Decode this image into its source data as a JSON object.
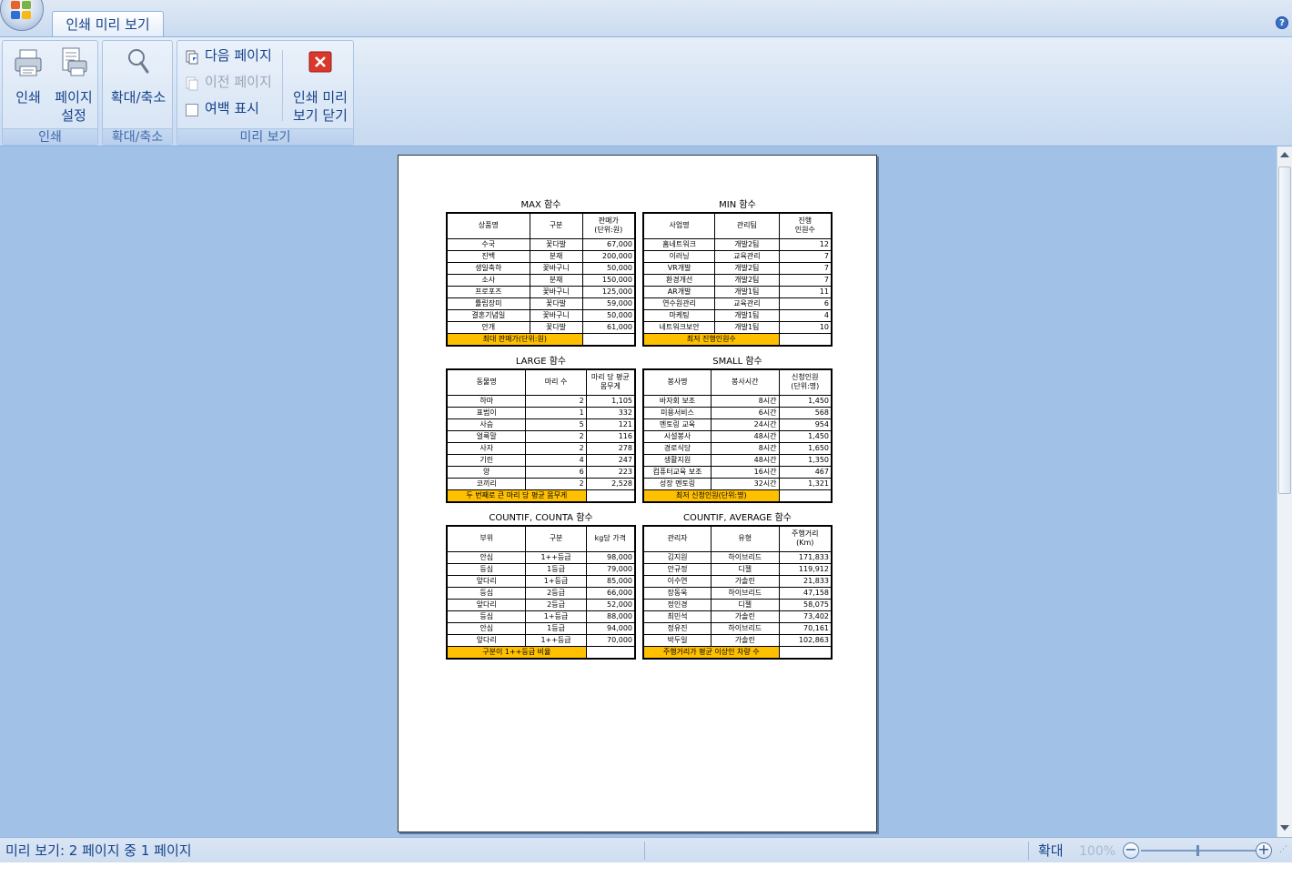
{
  "ribbon": {
    "tab": "인쇄 미리 보기",
    "groups": {
      "print": {
        "caption": "인쇄",
        "print_label": "인쇄",
        "page_setup_label_1": "페이지",
        "page_setup_label_2": "설정"
      },
      "zoom": {
        "caption": "확대/축소",
        "zoom_label": "확대/축소"
      },
      "preview": {
        "caption": "미리 보기",
        "next_page": "다음 페이지",
        "prev_page": "이전 페이지",
        "show_margins": "여백 표시",
        "close_label_1": "인쇄 미리",
        "close_label_2": "보기 닫기"
      }
    },
    "help_icon": "?"
  },
  "blocks": [
    {
      "title": "MAX 함수",
      "headers": [
        "상품명",
        "구분",
        "판매가\n(단위:원)"
      ],
      "rows": [
        [
          "수국",
          "꽃다발",
          "67,000"
        ],
        [
          "진백",
          "분재",
          "200,000"
        ],
        [
          "생일축하",
          "꽃바구니",
          "50,000"
        ],
        [
          "소사",
          "분재",
          "150,000"
        ],
        [
          "프로포즈",
          "꽃바구니",
          "125,000"
        ],
        [
          "튤립장미",
          "꽃다발",
          "59,000"
        ],
        [
          "결혼기념일",
          "꽃바구니",
          "50,000"
        ],
        [
          "안개",
          "꽃다발",
          "61,000"
        ]
      ],
      "aligns": [
        "c",
        "c",
        "r"
      ],
      "footer": "최대 판매가(단위:원)"
    },
    {
      "title": "MIN 함수",
      "headers": [
        "사업명",
        "관리팀",
        "진행\n인원수"
      ],
      "rows": [
        [
          "홈네트워크",
          "개발2팀",
          "12"
        ],
        [
          "이러닝",
          "교육관리",
          "7"
        ],
        [
          "VR개발",
          "개발2팀",
          "7"
        ],
        [
          "환경개선",
          "개발2팀",
          "7"
        ],
        [
          "AR개발",
          "개발1팀",
          "11"
        ],
        [
          "연수원관리",
          "교육관리",
          "6"
        ],
        [
          "마케팅",
          "개발1팀",
          "4"
        ],
        [
          "네트워크보안",
          "개발1팀",
          "10"
        ]
      ],
      "aligns": [
        "c",
        "c",
        "r"
      ],
      "footer": "최저 진행인원수"
    },
    {
      "title": "LARGE 함수",
      "headers": [
        "동물명",
        "마리 수",
        "마리 당 평균\n몸무게"
      ],
      "rows": [
        [
          "하마",
          "2",
          "1,105"
        ],
        [
          "표범이",
          "1",
          "332"
        ],
        [
          "사슴",
          "5",
          "121"
        ],
        [
          "얼룩말",
          "2",
          "116"
        ],
        [
          "사자",
          "2",
          "278"
        ],
        [
          "기린",
          "4",
          "247"
        ],
        [
          "양",
          "6",
          "223"
        ],
        [
          "코끼리",
          "2",
          "2,528"
        ]
      ],
      "aligns": [
        "c",
        "r",
        "r"
      ],
      "footer": "두 번째로 큰 마리 당 평균 몸무게"
    },
    {
      "title": "SMALL 함수",
      "headers": [
        "봉사명",
        "봉사시간",
        "신청인원\n(단위:명)"
      ],
      "rows": [
        [
          "바자회 보조",
          "8시간",
          "1,450"
        ],
        [
          "미용서비스",
          "6시간",
          "568"
        ],
        [
          "멘토링 교육",
          "24시간",
          "954"
        ],
        [
          "시설봉사",
          "48시간",
          "1,450"
        ],
        [
          "경로식당",
          "8시간",
          "1,650"
        ],
        [
          "생활지원",
          "48시간",
          "1,350"
        ],
        [
          "컴퓨터교육 보조",
          "16시간",
          "467"
        ],
        [
          "성장 멘토링",
          "32시간",
          "1,321"
        ]
      ],
      "aligns": [
        "c",
        "r",
        "r"
      ],
      "footer": "최저 신청인원(단위:명)"
    },
    {
      "title": "COUNTIF, COUNTA 함수",
      "headers": [
        "부위",
        "구분",
        "kg당 가격"
      ],
      "rows": [
        [
          "안심",
          "1++등급",
          "98,000"
        ],
        [
          "등심",
          "1등급",
          "79,000"
        ],
        [
          "앞다리",
          "1+등급",
          "85,000"
        ],
        [
          "등심",
          "2등급",
          "66,000"
        ],
        [
          "앞다리",
          "2등급",
          "52,000"
        ],
        [
          "등심",
          "1+등급",
          "88,000"
        ],
        [
          "안심",
          "1등급",
          "94,000"
        ],
        [
          "앞다리",
          "1++등급",
          "70,000"
        ]
      ],
      "aligns": [
        "c",
        "c",
        "r"
      ],
      "footer": "구분이 1++등급 비율"
    },
    {
      "title": "COUNTIF, AVERAGE 함수",
      "headers": [
        "관리자",
        "유형",
        "주행거리\n(Km)"
      ],
      "rows": [
        [
          "김지원",
          "하이브리드",
          "171,833"
        ],
        [
          "안규정",
          "디젤",
          "119,912"
        ],
        [
          "이수연",
          "가솔린",
          "21,833"
        ],
        [
          "장동욱",
          "하이브리드",
          "47,158"
        ],
        [
          "정인경",
          "디젤",
          "58,075"
        ],
        [
          "최민석",
          "가솔린",
          "73,402"
        ],
        [
          "정유진",
          "하이브리드",
          "70,161"
        ],
        [
          "박두일",
          "가솔린",
          "102,863"
        ]
      ],
      "aligns": [
        "c",
        "c",
        "r"
      ],
      "footer": "주행거리가 평균 이상인 차량 수"
    }
  ],
  "status": {
    "text": "미리 보기: 2 페이지 중 1 페이지",
    "zoom_label": "확대",
    "zoom_percent": "100%",
    "zoom_out": "−",
    "zoom_in": "+"
  },
  "colors": {
    "footer_highlight": "#ffc000",
    "workspace": "#a1c1e6",
    "ribbon_text": "#15428b"
  },
  "icons": {
    "office": "office-button-icon",
    "print": "printer-icon",
    "page_setup": "page-setup-icon",
    "zoom": "magnifier-icon",
    "next": "next-page-icon",
    "prev": "previous-page-icon",
    "close": "close-preview-icon"
  }
}
